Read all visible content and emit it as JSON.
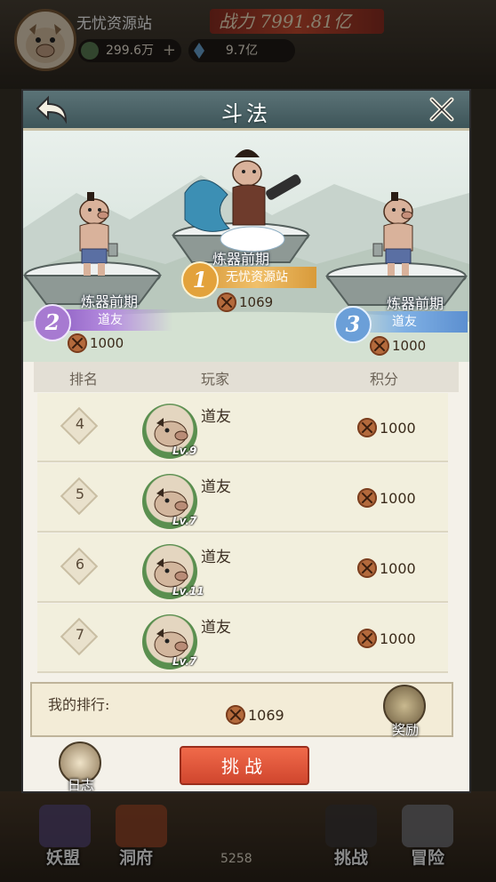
{
  "hud": {
    "player_name": "无忧资源站",
    "power": "战力 7991.81亿",
    "currency_1": "299.6万",
    "currency_2": "9.7亿"
  },
  "bottom_nav": {
    "items": [
      "妖盟",
      "洞府",
      "挑战",
      "冒险"
    ],
    "gold": "5258"
  },
  "dialog": {
    "title": "斗法",
    "podium": {
      "first": {
        "rank": "1",
        "realm": "炼器前期",
        "name": "无忧资源站",
        "score": "1069"
      },
      "second": {
        "rank": "2",
        "realm": "炼器前期",
        "name": "道友",
        "score": "1000"
      },
      "third": {
        "rank": "3",
        "realm": "炼器前期",
        "name": "道友",
        "score": "1000"
      }
    },
    "columns": {
      "rank": "排名",
      "player": "玩家",
      "score": "积分"
    },
    "rows": [
      {
        "rank": "4",
        "name": "道友",
        "level": "Lv.9",
        "score": "1000"
      },
      {
        "rank": "5",
        "name": "道友",
        "level": "Lv.7",
        "score": "1000"
      },
      {
        "rank": "6",
        "name": "道友",
        "level": "Lv.11",
        "score": "1000"
      },
      {
        "rank": "7",
        "name": "道友",
        "level": "Lv.7",
        "score": "1000"
      }
    ],
    "my_rank": {
      "label": "我的排行:",
      "score": "1069"
    },
    "reward_label": "奖励",
    "log_label": "日志",
    "challenge_label": "挑战"
  },
  "colors": {
    "title_bar": "#4a6266",
    "challenge_button": "#e4563a",
    "first_medal": "#e3a23b",
    "second_medal": "#a77ad1",
    "third_medal": "#6b9fd8"
  }
}
